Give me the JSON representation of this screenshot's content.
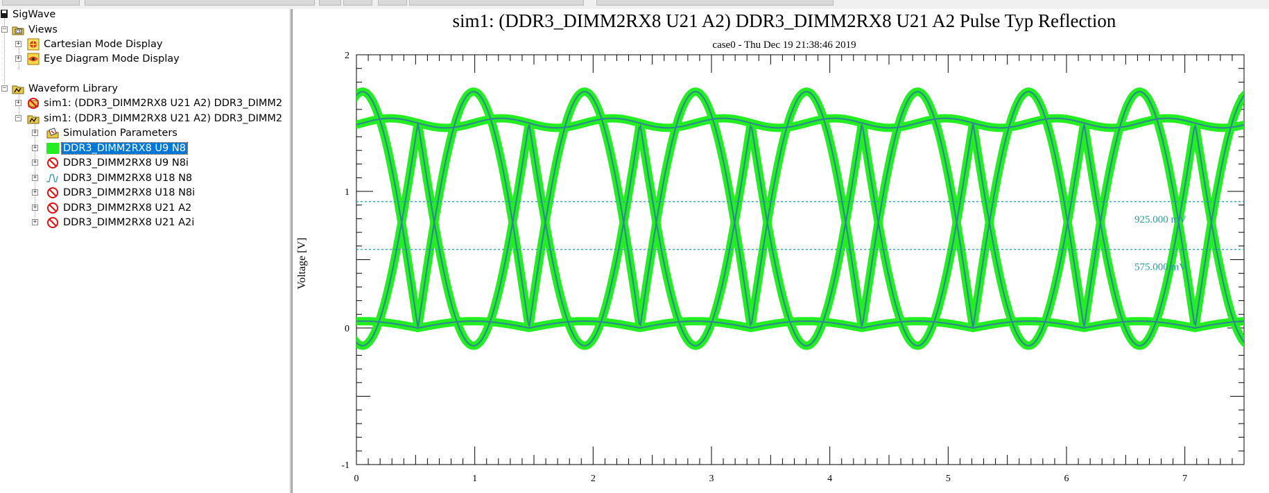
{
  "tree": {
    "root_label": "SigWave",
    "views_label": "Views",
    "views_items": [
      "Cartesian Mode Display",
      "Eye Diagram Mode Display"
    ],
    "library_label": "Waveform Library",
    "sim_items": [
      "sim1: (DDR3_DIMM2RX8 U21 A2) DDR3_DIMM2",
      "sim1: (DDR3_DIMM2RX8 U21 A2) DDR3_DIMM2"
    ],
    "waveforms": [
      {
        "label": "Simulation Parameters",
        "icon": "parameters-icon"
      },
      {
        "label": "DDR3_DIMM2RX8 U9 N8",
        "icon": "green-waveform-icon",
        "selected": true
      },
      {
        "label": "DDR3_DIMM2RX8 U9 N8i",
        "icon": "hidden-waveform-icon"
      },
      {
        "label": "DDR3_DIMM2RX8 U18 N8",
        "icon": "waveform-trace-icon"
      },
      {
        "label": "DDR3_DIMM2RX8 U18 N8i",
        "icon": "hidden-waveform-icon"
      },
      {
        "label": "DDR3_DIMM2RX8 U21 A2",
        "icon": "hidden-waveform-icon"
      },
      {
        "label": "DDR3_DIMM2RX8 U21 A2i",
        "icon": "hidden-waveform-icon"
      }
    ]
  },
  "chart": {
    "title": "sim1: (DDR3_DIMM2RX8 U21 A2) DDR3_DIMM2RX8 U21 A2 Pulse Typ Reflection",
    "subtitle": "case0 - Thu Dec 19 21:38:46 2019",
    "ylabel": "Voltage [V]",
    "ref_labels": [
      "925.000 mV",
      "575.000 mV"
    ]
  },
  "colors": {
    "trace_outer": "#22ee22",
    "trace_inner": "#2f8a8f",
    "ref_line": "#2a9a9a",
    "selection": "#0078d7"
  },
  "chart_data": {
    "type": "line",
    "mode": "eye diagram",
    "xlim": [
      0,
      7.5
    ],
    "ylim": [
      -1,
      2
    ],
    "x_ticks": [
      "0",
      "1",
      "2",
      "3",
      "4",
      "5",
      "6",
      "7"
    ],
    "y_ticks": [
      "2",
      "1",
      "0",
      "-1"
    ],
    "unit_interval": 0.938,
    "first_crossing_x": 0.52,
    "levels": {
      "high": 1.5,
      "low": 0.0
    },
    "overshoot": {
      "high": 1.73,
      "low": -0.13
    },
    "crossing_voltage": 0.875,
    "reference_lines": [
      {
        "value": 0.925,
        "label": "925.000 mV"
      },
      {
        "value": 0.575,
        "label": "575.000 mV"
      }
    ],
    "grid": false
  }
}
